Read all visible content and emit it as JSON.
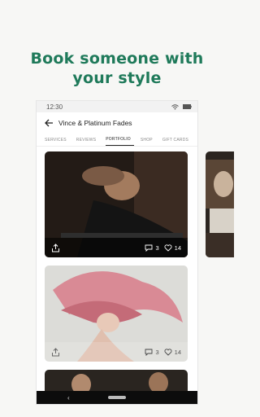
{
  "headline": {
    "line1": "Book someone with",
    "line2": "your style"
  },
  "status_bar": {
    "time": "12:30",
    "icons": [
      "wifi-icon",
      "battery-icon"
    ]
  },
  "app_bar": {
    "back_icon": "arrow-left-icon",
    "title": "Vince & Platinum Fades"
  },
  "tabs": [
    {
      "label": "SERVICES",
      "active": false
    },
    {
      "label": "REVIEWS",
      "active": false
    },
    {
      "label": "PORTFOLIO",
      "active": true
    },
    {
      "label": "SHOP",
      "active": false
    },
    {
      "label": "GIFT CARDS",
      "active": false
    }
  ],
  "portfolio": [
    {
      "subject": "barber trimming beard",
      "comments": "3",
      "likes": "14"
    },
    {
      "subject": "pink hair in motion",
      "comments": "3",
      "likes": "14"
    },
    {
      "subject": "barbers at work",
      "comments": "",
      "likes": ""
    }
  ],
  "colors": {
    "brand": "#1f7a5a",
    "background": "#f7f7f5",
    "nav_bar": "#0c0c0c"
  }
}
